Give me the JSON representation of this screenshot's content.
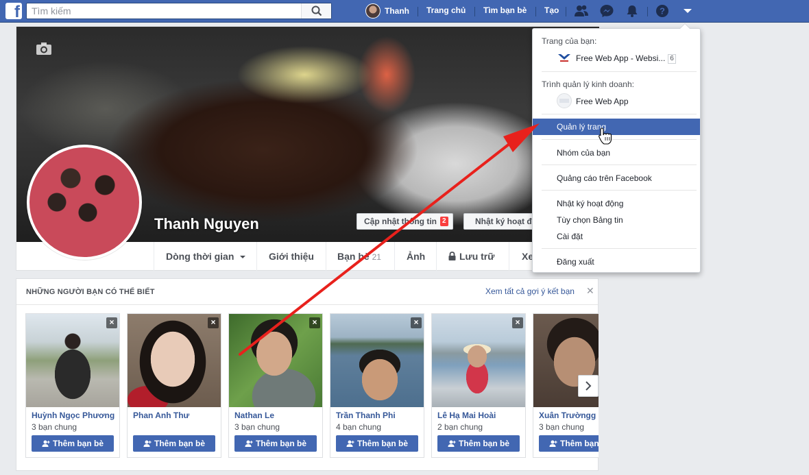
{
  "topbar": {
    "search_placeholder": "Tìm kiếm",
    "user_name": "Thanh",
    "home": "Trang chủ",
    "find_friends": "Tìm bạn bè",
    "create": "Tạo"
  },
  "profile": {
    "name": "Thanh Nguyen",
    "update_info": "Cập nhật thông tin",
    "update_badge": "2",
    "activity_log": "Nhật ký hoạt động"
  },
  "tabs": [
    {
      "label": "Dòng thời gian"
    },
    {
      "label": "Giới thiệu"
    },
    {
      "label": "Bạn bè",
      "count": "21"
    },
    {
      "label": "Ảnh"
    },
    {
      "label": "Lưu trữ"
    },
    {
      "label": "Xem"
    }
  ],
  "pymk": {
    "title": "NHỮNG NGƯỜI BẠN CÓ THỂ BIẾT",
    "see_all": "Xem tất cả gợi ý kết bạn",
    "add_friend": "Thêm bạn bè",
    "people": [
      {
        "name": "Huỳnh Ngọc Phương",
        "mutual": "3 bạn chung",
        "photo_color": "#9aa78a"
      },
      {
        "name": "Phan Anh Thư",
        "mutual": "",
        "photo_color": "#8a7a70"
      },
      {
        "name": "Nathan Le",
        "mutual": "3 bạn chung",
        "photo_color": "#5d8a4a"
      },
      {
        "name": "Trần Thanh Phi",
        "mutual": "4 bạn chung",
        "photo_color": "#6c8fae"
      },
      {
        "name": "Lê Hạ Mai Hoài",
        "mutual": "2 bạn chung",
        "photo_color": "#9fb7c9"
      },
      {
        "name": "Xuân Trườngg",
        "mutual": "3 bạn chung",
        "photo_color": "#5a4a40"
      }
    ]
  },
  "menu": {
    "your_pages": "Trang của bạn:",
    "page_name": "Free Web App - Websi...",
    "page_count": "6",
    "business_manager": "Trình quản lý kinh doanh:",
    "business_name": "Free Web App",
    "manage_pages": "Quản lý trang",
    "your_groups": "Nhóm của bạn",
    "ads": "Quảng cáo trên Facebook",
    "activity_log": "Nhật ký hoạt động",
    "news_feed_prefs": "Tùy chọn Bảng tin",
    "settings": "Cài đặt",
    "logout": "Đăng xuất"
  },
  "colors": {
    "brand": "#4267b2",
    "highlight": "#4267b2",
    "arrow": "#e8211c"
  }
}
